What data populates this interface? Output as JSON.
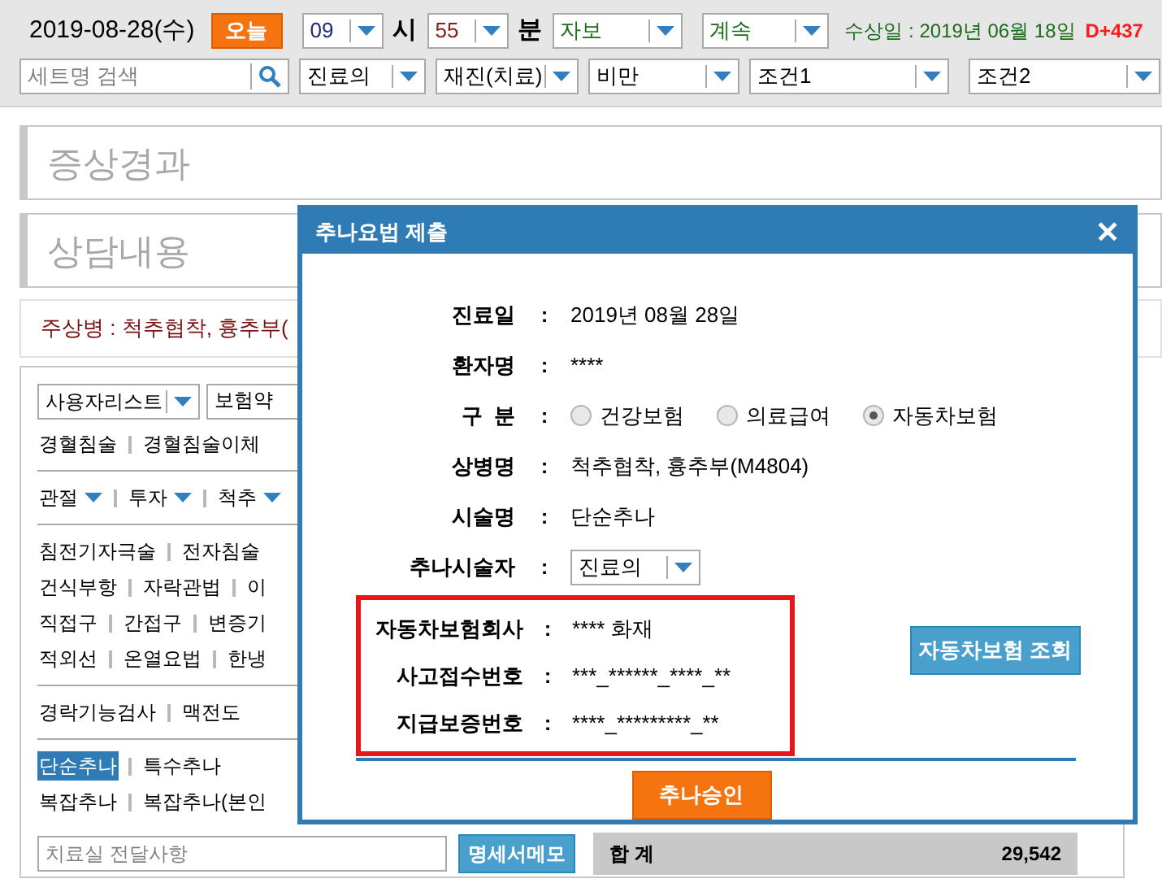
{
  "toolbar": {
    "date": "2019-08-28(수)",
    "today_button": "오늘",
    "hour": "09",
    "hour_unit": "시",
    "minute": "55",
    "minute_unit": "분",
    "insurance": "자보",
    "visit": "계속",
    "injury_date": "수상일 : 2019년 06월 18일",
    "injury_days": "D+437"
  },
  "filters": {
    "search_placeholder": "세트명 검색",
    "selects": [
      "진료의",
      "재진(치료)",
      "비만",
      "조건1",
      "조건2"
    ]
  },
  "sections": [
    {
      "placeholder": "증상경과"
    },
    {
      "placeholder": "상담내용"
    }
  ],
  "main_diagnosis": "주상병 : 척추협착, 흉추부(",
  "panel": {
    "selects": [
      "사용자리스트",
      "보험약"
    ],
    "groups": [
      {
        "rows": [
          {
            "items": [
              {
                "label": "경혈침술",
                "dropdown": false,
                "selected": false
              },
              {
                "label": "경혈침술이체",
                "dropdown": false,
                "selected": false
              }
            ]
          }
        ]
      },
      {
        "rows": [
          {
            "items": [
              {
                "label": "관절",
                "dropdown": true,
                "selected": false
              },
              {
                "label": "투자",
                "dropdown": true,
                "selected": false
              },
              {
                "label": "척추",
                "dropdown": true,
                "selected": false
              }
            ]
          }
        ]
      },
      {
        "rows": [
          {
            "items": [
              {
                "label": "침전기자극술",
                "dropdown": false,
                "selected": false
              },
              {
                "label": "전자침술",
                "dropdown": false,
                "selected": false
              }
            ]
          },
          {
            "items": [
              {
                "label": "건식부항",
                "dropdown": false,
                "selected": false
              },
              {
                "label": "자락관법",
                "dropdown": false,
                "selected": false
              },
              {
                "label": "이",
                "dropdown": false,
                "selected": false
              }
            ]
          },
          {
            "items": [
              {
                "label": "직접구",
                "dropdown": false,
                "selected": false
              },
              {
                "label": "간접구",
                "dropdown": false,
                "selected": false
              },
              {
                "label": "변증기",
                "dropdown": false,
                "selected": false
              }
            ]
          },
          {
            "items": [
              {
                "label": "적외선",
                "dropdown": false,
                "selected": false
              },
              {
                "label": "온열요법",
                "dropdown": false,
                "selected": false
              },
              {
                "label": "한냉",
                "dropdown": false,
                "selected": false
              }
            ]
          }
        ]
      },
      {
        "rows": [
          {
            "items": [
              {
                "label": "경락기능검사",
                "dropdown": false,
                "selected": false
              },
              {
                "label": "맥전도",
                "dropdown": false,
                "selected": false
              }
            ]
          }
        ]
      },
      {
        "rows": [
          {
            "items": [
              {
                "label": "단순추나",
                "dropdown": false,
                "selected": true
              },
              {
                "label": "특수추나",
                "dropdown": false,
                "selected": false
              }
            ]
          },
          {
            "items": [
              {
                "label": "복잡추나",
                "dropdown": false,
                "selected": false
              },
              {
                "label": "복잡추나(본인",
                "dropdown": false,
                "selected": false
              }
            ]
          }
        ]
      }
    ],
    "memo_placeholder": "치료실 전달사항",
    "memo_button": "명세서메모"
  },
  "summary": {
    "label": "합 계",
    "value": "29,542"
  },
  "dialog": {
    "title": "추나요법 제출",
    "close": "✕",
    "fields": [
      {
        "label": "진료일",
        "colon": ":",
        "value": "2019년 08월 28일"
      },
      {
        "label": "환자명",
        "colon": ":",
        "value": "****"
      }
    ],
    "category": {
      "label": "구  분",
      "colon": ":",
      "options": [
        {
          "label": "건강보험",
          "selected": false
        },
        {
          "label": "의료급여",
          "selected": false
        },
        {
          "label": "자동차보험",
          "selected": true
        }
      ]
    },
    "fields2": [
      {
        "label": "상병명",
        "colon": ":",
        "value": "척추협착, 흉추부(M4804)"
      },
      {
        "label": "시술명",
        "colon": ":",
        "value": "단순추나"
      }
    ],
    "practitioner": {
      "label": "추나시술자",
      "colon": ":",
      "value": "진료의"
    },
    "insurance_fields": [
      {
        "label": "자동차보험회사",
        "colon": ":",
        "value": "**** 화재"
      },
      {
        "label": "사고접수번호",
        "colon": ":",
        "value": "***_******_****_**"
      },
      {
        "label": "지급보증번호",
        "colon": ":",
        "value": "****_*********_**"
      }
    ],
    "lookup_button": "자동차보험 조회",
    "submit_button": "추나승인"
  }
}
